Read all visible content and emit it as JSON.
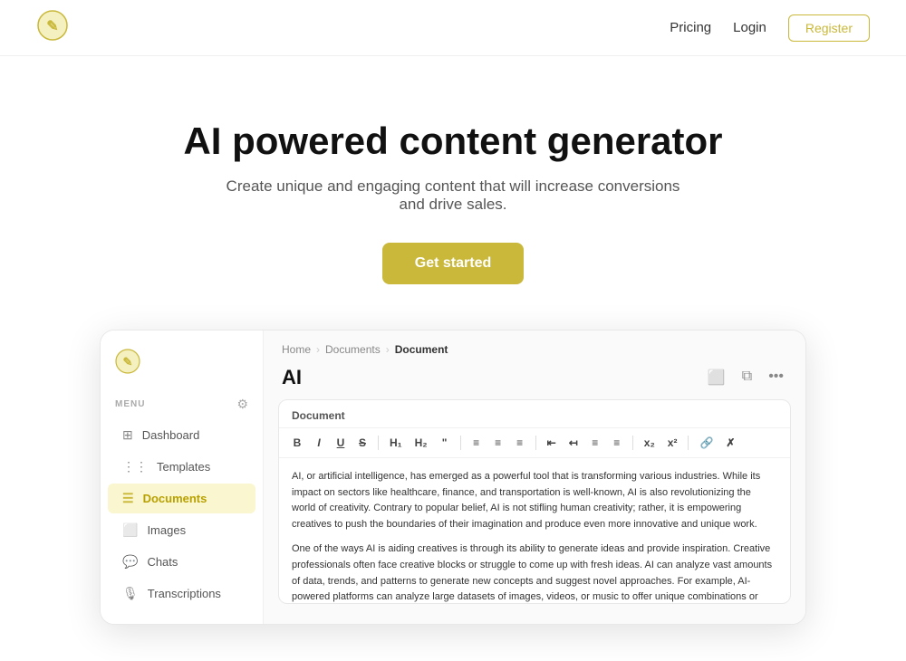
{
  "nav": {
    "pricing_label": "Pricing",
    "login_label": "Login",
    "register_label": "Register"
  },
  "hero": {
    "title": "AI powered content generator",
    "subtitle": "Create unique and engaging content that will increase conversions and drive sales.",
    "cta_label": "Get started"
  },
  "preview": {
    "breadcrumb": {
      "home": "Home",
      "documents": "Documents",
      "current": "Document",
      "sep1": "›",
      "sep2": "›"
    },
    "doc_title": "AI",
    "editor_label": "Document",
    "toolbar_buttons": [
      "B",
      "I",
      "U",
      "S",
      "H₁",
      "H₂",
      "\"",
      "≡",
      "≡",
      "≡",
      "⇤",
      "↤",
      "≡",
      "≡",
      "≡",
      "x₂",
      "x²",
      "🔗",
      "✗"
    ],
    "body_para1": "AI, or artificial intelligence, has emerged as a powerful tool that is transforming various industries. While its impact on sectors like healthcare, finance, and transportation is well-known, AI is also revolutionizing the world of creativity. Contrary to popular belief, AI is not stifling human creativity; rather, it is empowering creatives to push the boundaries of their imagination and produce even more innovative and unique work.",
    "body_para2": "One of the ways AI is aiding creatives is through its ability to generate ideas and provide inspiration. Creative professionals often face creative blocks or struggle to come up with fresh ideas. AI can analyze vast amounts of data, trends, and patterns to generate new concepts and suggest novel approaches. For example, AI-powered platforms can analyze large datasets of images, videos, or music to offer unique combinations or recommendations that artists can use as a starting point for their creative process. This not only saves time but also expands the creative possibilities for artists."
  },
  "sidebar": {
    "menu_label": "MENU",
    "items": [
      {
        "id": "dashboard",
        "label": "Dashboard",
        "icon": "⊞"
      },
      {
        "id": "templates",
        "label": "Templates",
        "icon": "⋮⋮"
      },
      {
        "id": "documents",
        "label": "Documents",
        "icon": "☰",
        "active": true
      },
      {
        "id": "images",
        "label": "Images",
        "icon": "⬜"
      },
      {
        "id": "chats",
        "label": "Chats",
        "icon": "💬"
      },
      {
        "id": "transcriptions",
        "label": "Transcriptions",
        "icon": "🎙"
      }
    ]
  }
}
